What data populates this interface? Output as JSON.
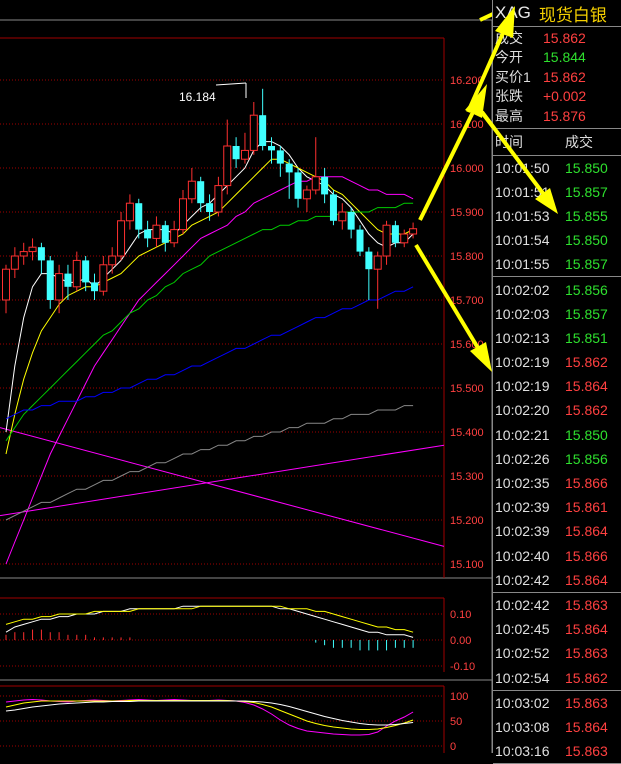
{
  "colors": {
    "up": "#ff4040",
    "down": "#2ee02e",
    "bull_candle": "#ff3030",
    "bear_candle": "#40ffff",
    "grid": "#a00000",
    "axis_text": "#ff4040",
    "symbol": "#e8e8e8",
    "name": "#f5d000",
    "arrow": "#ffff00",
    "ma5": "#ffffff",
    "ma10": "#ffff00",
    "ma20": "#ff00ff",
    "ma60": "#00cc00",
    "ma120": "#0000ff",
    "ma250": "#888888"
  },
  "header": {
    "symbol": "XAG",
    "name": "现货白银"
  },
  "quote": [
    {
      "label": "成交",
      "value": "15.862",
      "color": "up"
    },
    {
      "label": "今开",
      "value": "15.844",
      "color": "down"
    },
    {
      "label": "买价1",
      "value": "15.862",
      "color": "up"
    },
    {
      "label": "张跌",
      "value": "+0.002",
      "color": "up"
    },
    {
      "label": "最高",
      "value": "15.876",
      "color": "up"
    }
  ],
  "trades_header": {
    "time": "时间",
    "price": "成交"
  },
  "trade_groups": [
    [
      {
        "time": "10:01:50",
        "price": "15.850",
        "color": "down"
      },
      {
        "time": "10:01:51",
        "price": "15.857",
        "color": "down"
      },
      {
        "time": "10:01:53",
        "price": "15.855",
        "color": "down"
      },
      {
        "time": "10:01:54",
        "price": "15.850",
        "color": "down"
      },
      {
        "time": "10:01:55",
        "price": "15.857",
        "color": "down"
      }
    ],
    [
      {
        "time": "10:02:02",
        "price": "15.856",
        "color": "down"
      },
      {
        "time": "10:02:03",
        "price": "15.857",
        "color": "down"
      },
      {
        "time": "10:02:13",
        "price": "15.851",
        "color": "down"
      },
      {
        "time": "10:02:19",
        "price": "15.862",
        "color": "up"
      },
      {
        "time": "10:02:19",
        "price": "15.864",
        "color": "up"
      },
      {
        "time": "10:02:20",
        "price": "15.862",
        "color": "up"
      },
      {
        "time": "10:02:21",
        "price": "15.850",
        "color": "down"
      },
      {
        "time": "10:02:26",
        "price": "15.856",
        "color": "down"
      },
      {
        "time": "10:02:35",
        "price": "15.866",
        "color": "up"
      },
      {
        "time": "10:02:39",
        "price": "15.861",
        "color": "up"
      },
      {
        "time": "10:02:39",
        "price": "15.864",
        "color": "up"
      },
      {
        "time": "10:02:40",
        "price": "15.866",
        "color": "up"
      },
      {
        "time": "10:02:42",
        "price": "15.864",
        "color": "up"
      }
    ],
    [
      {
        "time": "10:02:42",
        "price": "15.863",
        "color": "up"
      },
      {
        "time": "10:02:45",
        "price": "15.864",
        "color": "up"
      },
      {
        "time": "10:02:52",
        "price": "15.863",
        "color": "up"
      },
      {
        "time": "10:02:54",
        "price": "15.862",
        "color": "up"
      }
    ],
    [
      {
        "time": "10:03:02",
        "price": "15.863",
        "color": "up"
      },
      {
        "time": "10:03:08",
        "price": "15.864",
        "color": "up"
      },
      {
        "time": "10:03:16",
        "price": "15.863",
        "color": "up"
      }
    ]
  ],
  "chart_data": [
    {
      "type": "candlestick",
      "title": "",
      "y_ticks": [
        "16.200",
        "16.100",
        "16.000",
        "15.900",
        "15.800",
        "15.700",
        "15.600",
        "15.500",
        "15.400",
        "15.300",
        "15.200",
        "15.100"
      ],
      "ylim": [
        15.1,
        16.25
      ],
      "high_annotation": "16.184",
      "grid": true,
      "candles": [
        [
          15.7,
          15.77,
          15.78,
          15.67
        ],
        [
          15.77,
          15.8,
          15.82,
          15.75
        ],
        [
          15.8,
          15.81,
          15.83,
          15.78
        ],
        [
          15.81,
          15.82,
          15.84,
          15.79
        ],
        [
          15.82,
          15.79,
          15.83,
          15.76
        ],
        [
          15.79,
          15.7,
          15.8,
          15.68
        ],
        [
          15.7,
          15.76,
          15.78,
          15.67
        ],
        [
          15.76,
          15.73,
          15.78,
          15.7
        ],
        [
          15.73,
          15.79,
          15.81,
          15.72
        ],
        [
          15.79,
          15.74,
          15.8,
          15.72
        ],
        [
          15.74,
          15.72,
          15.76,
          15.7
        ],
        [
          15.72,
          15.78,
          15.8,
          15.71
        ],
        [
          15.78,
          15.8,
          15.82,
          15.76
        ],
        [
          15.8,
          15.88,
          15.9,
          15.79
        ],
        [
          15.88,
          15.92,
          15.94,
          15.86
        ],
        [
          15.92,
          15.86,
          15.93,
          15.84
        ],
        [
          15.86,
          15.84,
          15.88,
          15.82
        ],
        [
          15.84,
          15.87,
          15.89,
          15.82
        ],
        [
          15.87,
          15.83,
          15.88,
          15.81
        ],
        [
          15.83,
          15.86,
          15.88,
          15.82
        ],
        [
          15.86,
          15.93,
          15.95,
          15.85
        ],
        [
          15.93,
          15.97,
          16.0,
          15.92
        ],
        [
          15.97,
          15.92,
          15.98,
          15.9
        ],
        [
          15.92,
          15.9,
          15.94,
          15.88
        ],
        [
          15.9,
          15.96,
          15.98,
          15.89
        ],
        [
          15.96,
          16.05,
          16.11,
          15.94
        ],
        [
          16.05,
          16.02,
          16.07,
          16.0
        ],
        [
          16.02,
          16.04,
          16.08,
          16.01
        ],
        [
          16.04,
          16.12,
          16.15,
          16.03
        ],
        [
          16.12,
          16.05,
          16.18,
          16.04
        ],
        [
          16.05,
          16.04,
          16.07,
          16.01
        ],
        [
          16.04,
          16.01,
          16.05,
          15.98
        ],
        [
          16.01,
          15.99,
          16.02,
          15.93
        ],
        [
          15.99,
          15.93,
          16.0,
          15.91
        ],
        [
          15.93,
          15.95,
          15.96,
          15.9
        ],
        [
          15.95,
          15.98,
          16.07,
          15.94
        ],
        [
          15.98,
          15.94,
          16.0,
          15.92
        ],
        [
          15.94,
          15.88,
          15.95,
          15.87
        ],
        [
          15.88,
          15.9,
          15.92,
          15.86
        ],
        [
          15.9,
          15.86,
          15.91,
          15.84
        ],
        [
          15.86,
          15.81,
          15.87,
          15.8
        ],
        [
          15.81,
          15.77,
          15.82,
          15.7
        ],
        [
          15.77,
          15.8,
          15.81,
          15.68
        ],
        [
          15.8,
          15.87,
          15.88,
          15.78
        ],
        [
          15.87,
          15.83,
          15.88,
          15.82
        ],
        [
          15.83,
          15.85,
          15.86,
          15.82
        ],
        [
          15.85,
          15.862,
          15.876,
          15.84
        ]
      ],
      "ma_lines": {
        "ma5": [
          15.4,
          15.55,
          15.66,
          15.73,
          15.76,
          15.76,
          15.75,
          15.74,
          15.74,
          15.75,
          15.73,
          15.75,
          15.77,
          15.79,
          15.82,
          15.85,
          15.86,
          15.86,
          15.86,
          15.85,
          15.87,
          15.89,
          15.91,
          15.92,
          15.94,
          15.96,
          15.98,
          16.0,
          16.04,
          16.06,
          16.06,
          16.05,
          16.03,
          16.0,
          15.98,
          15.97,
          15.96,
          15.94,
          15.93,
          15.91,
          15.88,
          15.85,
          15.83,
          15.82,
          15.83,
          15.83,
          15.85
        ],
        "ma10": [
          15.35,
          15.44,
          15.52,
          15.58,
          15.63,
          15.66,
          15.69,
          15.71,
          15.72,
          15.73,
          15.73,
          15.74,
          15.75,
          15.76,
          15.78,
          15.8,
          15.81,
          15.82,
          15.83,
          15.84,
          15.85,
          15.87,
          15.88,
          15.89,
          15.9,
          15.92,
          15.94,
          15.96,
          15.98,
          16.0,
          16.02,
          16.02,
          16.01,
          16.0,
          15.99,
          15.98,
          15.97,
          15.95,
          15.94,
          15.92,
          15.9,
          15.88,
          15.86,
          15.85,
          15.85,
          15.85,
          15.86
        ],
        "ma20": [
          15.1,
          15.15,
          15.2,
          15.25,
          15.3,
          15.35,
          15.39,
          15.43,
          15.47,
          15.51,
          15.55,
          15.58,
          15.61,
          15.64,
          15.67,
          15.7,
          15.72,
          15.74,
          15.76,
          15.78,
          15.8,
          15.82,
          15.84,
          15.85,
          15.86,
          15.87,
          15.89,
          15.9,
          15.92,
          15.93,
          15.94,
          15.95,
          15.96,
          15.97,
          15.97,
          15.98,
          15.98,
          15.98,
          15.98,
          15.97,
          15.96,
          15.95,
          15.95,
          15.94,
          15.94,
          15.94,
          15.93
        ],
        "ma60": [
          15.38,
          15.41,
          15.44,
          15.46,
          15.48,
          15.5,
          15.52,
          15.54,
          15.56,
          15.58,
          15.6,
          15.62,
          15.63,
          15.65,
          15.67,
          15.68,
          15.7,
          15.71,
          15.73,
          15.74,
          15.76,
          15.77,
          15.78,
          15.8,
          15.81,
          15.82,
          15.83,
          15.84,
          15.85,
          15.86,
          15.86,
          15.87,
          15.87,
          15.88,
          15.88,
          15.89,
          15.89,
          15.89,
          15.9,
          15.9,
          15.9,
          15.9,
          15.91,
          15.91,
          15.91,
          15.92,
          15.92
        ],
        "ma120": [
          15.43,
          15.44,
          15.45,
          15.45,
          15.46,
          15.46,
          15.47,
          15.47,
          15.47,
          15.48,
          15.48,
          15.49,
          15.49,
          15.5,
          15.5,
          15.51,
          15.52,
          15.52,
          15.53,
          15.53,
          15.54,
          15.55,
          15.55,
          15.56,
          15.57,
          15.58,
          15.59,
          15.59,
          15.6,
          15.61,
          15.62,
          15.62,
          15.63,
          15.64,
          15.65,
          15.66,
          15.66,
          15.67,
          15.68,
          15.68,
          15.69,
          15.7,
          15.7,
          15.71,
          15.72,
          15.72,
          15.73
        ],
        "ma250": [
          15.2,
          15.21,
          15.22,
          15.23,
          15.24,
          15.24,
          15.25,
          15.26,
          15.27,
          15.27,
          15.28,
          15.29,
          15.29,
          15.3,
          15.31,
          15.31,
          15.32,
          15.33,
          15.33,
          15.34,
          15.35,
          15.35,
          15.36,
          15.36,
          15.37,
          15.37,
          15.38,
          15.38,
          15.39,
          15.39,
          15.4,
          15.4,
          15.41,
          15.41,
          15.42,
          15.42,
          15.42,
          15.43,
          15.43,
          15.44,
          15.44,
          15.44,
          15.45,
          15.45,
          15.45,
          15.46,
          15.46
        ]
      },
      "trend_lines": [
        {
          "from": [
            0,
            15.41
          ],
          "to": [
            46,
            15.14
          ],
          "color": "ma20"
        },
        {
          "from": [
            0,
            15.21
          ],
          "to": [
            46,
            15.37
          ],
          "color": "ma20"
        }
      ]
    },
    {
      "type": "bar",
      "title": "",
      "y_ticks": [
        "0.10",
        "0.00",
        "-0.10"
      ],
      "ylim": [
        -0.12,
        0.15
      ],
      "values": [
        0.02,
        0.03,
        0.03,
        0.04,
        0.04,
        0.03,
        0.03,
        0.02,
        0.02,
        0.02,
        0.01,
        0.01,
        0.01,
        0.01,
        0.01,
        0.0,
        0.0,
        0.0,
        0.0,
        0.0,
        0.0,
        0.0,
        0.0,
        0.0,
        0.0,
        0.0,
        0.0,
        0.0,
        0.0,
        0.0,
        0.0,
        0.0,
        0.0,
        0.0,
        0.0,
        -0.01,
        -0.02,
        -0.03,
        -0.03,
        -0.03,
        -0.04,
        -0.04,
        -0.04,
        -0.04,
        -0.03,
        -0.03,
        -0.03
      ],
      "lines": {
        "dif": [
          0.03,
          0.05,
          0.06,
          0.07,
          0.08,
          0.08,
          0.09,
          0.09,
          0.1,
          0.1,
          0.1,
          0.11,
          0.11,
          0.11,
          0.12,
          0.12,
          0.12,
          0.12,
          0.12,
          0.12,
          0.13,
          0.13,
          0.13,
          0.13,
          0.13,
          0.13,
          0.13,
          0.13,
          0.13,
          0.13,
          0.13,
          0.12,
          0.12,
          0.11,
          0.1,
          0.09,
          0.08,
          0.07,
          0.06,
          0.05,
          0.04,
          0.03,
          0.03,
          0.02,
          0.02,
          0.02,
          0.01
        ],
        "dea": [
          0.06,
          0.07,
          0.08,
          0.08,
          0.09,
          0.09,
          0.1,
          0.1,
          0.1,
          0.1,
          0.11,
          0.11,
          0.11,
          0.11,
          0.11,
          0.12,
          0.12,
          0.12,
          0.12,
          0.12,
          0.12,
          0.12,
          0.13,
          0.13,
          0.13,
          0.13,
          0.13,
          0.13,
          0.13,
          0.13,
          0.13,
          0.13,
          0.12,
          0.12,
          0.12,
          0.11,
          0.11,
          0.1,
          0.09,
          0.08,
          0.07,
          0.06,
          0.05,
          0.05,
          0.04,
          0.04,
          0.03
        ]
      }
    },
    {
      "type": "line",
      "title": "",
      "y_ticks": [
        "100",
        "50",
        "0"
      ],
      "ylim": [
        0,
        110
      ],
      "series": [
        {
          "color": "ma20",
          "values": [
            88,
            90,
            92,
            93,
            92,
            90,
            89,
            88,
            90,
            91,
            92,
            91,
            90,
            91,
            92,
            93,
            92,
            91,
            92,
            93,
            92,
            91,
            90,
            91,
            92,
            91,
            90,
            87,
            82,
            74,
            64,
            52,
            42,
            35,
            30,
            28,
            26,
            24,
            23,
            22,
            22,
            23,
            28,
            40,
            50,
            58,
            68
          ]
        },
        {
          "color": "ma10",
          "values": [
            78,
            82,
            86,
            88,
            90,
            90,
            90,
            90,
            90,
            90,
            90,
            90,
            90,
            90,
            91,
            91,
            91,
            91,
            91,
            91,
            91,
            91,
            91,
            91,
            91,
            91,
            90,
            89,
            87,
            83,
            78,
            71,
            64,
            57,
            50,
            45,
            41,
            38,
            36,
            34,
            33,
            33,
            34,
            37,
            41,
            46,
            52
          ]
        },
        {
          "color": "ma5",
          "values": [
            70,
            72,
            75,
            78,
            80,
            82,
            84,
            85,
            86,
            87,
            88,
            88,
            89,
            89,
            89,
            90,
            90,
            90,
            90,
            90,
            90,
            90,
            90,
            90,
            90,
            90,
            90,
            90,
            89,
            88,
            86,
            83,
            79,
            74,
            69,
            64,
            59,
            55,
            51,
            48,
            45,
            43,
            42,
            42,
            43,
            45,
            47
          ]
        }
      ]
    }
  ]
}
